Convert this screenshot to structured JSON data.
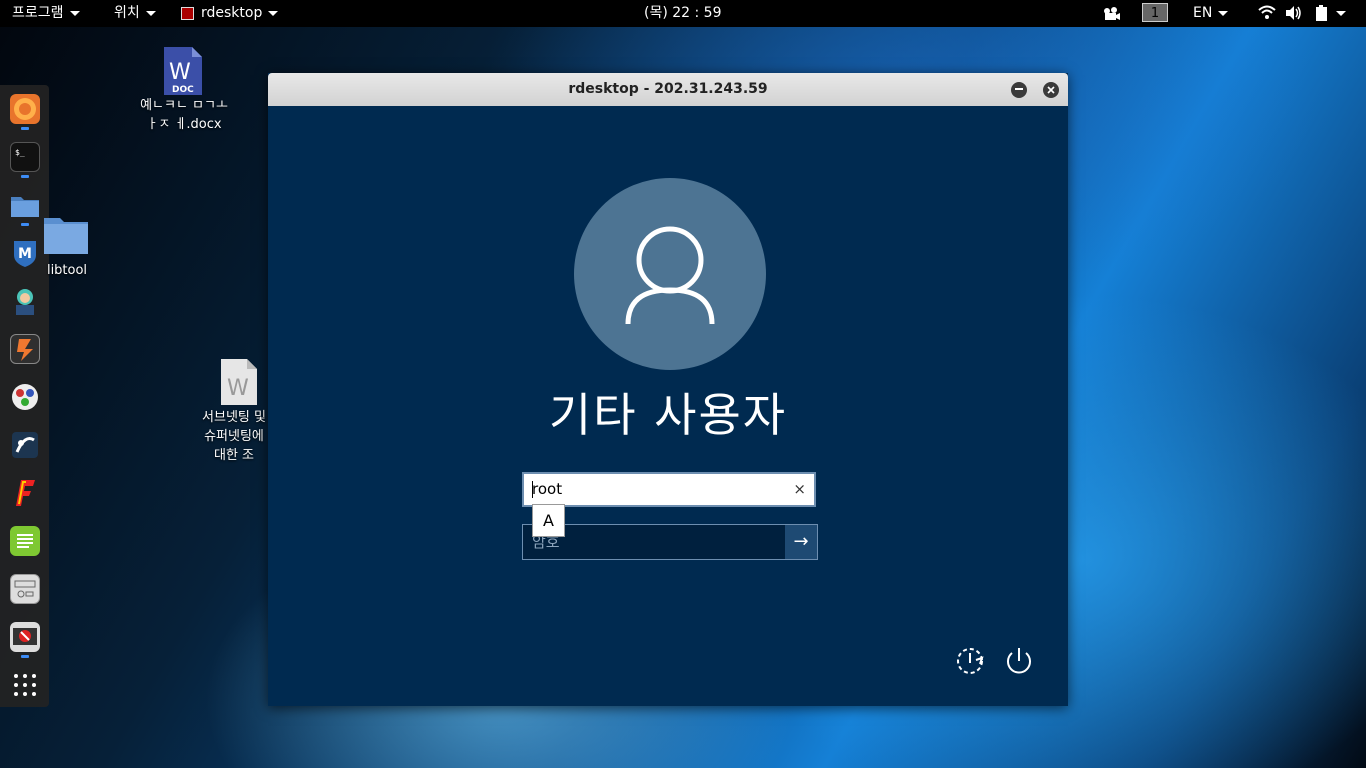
{
  "topbar": {
    "programs": "프로그램",
    "places": "위치",
    "active_app": "rdesktop",
    "clock": "(목) 22 : 59",
    "workspace": "1",
    "lang": "EN"
  },
  "desktop": {
    "icons": [
      {
        "label": "예ㄴㅋㄴ ㅁㄱㅗㅏㅈ ㅔ.docx",
        "badge": "DOC"
      },
      {
        "label": "libtool"
      },
      {
        "label": "서브넷팅 및 슈퍼넷팅에 대한 조사.docx"
      }
    ]
  },
  "window": {
    "title": "rdesktop - 202.31.243.59",
    "login": {
      "user_display": "기타 사용자",
      "username_value": "root",
      "password_placeholder": "암호",
      "ime_indicator": "A",
      "clear_glyph": "×",
      "submit_glyph": "→"
    }
  },
  "colors": {
    "window_bg": "#002a50",
    "avatar_bg": "#4d7493",
    "input_border": "#6d8eb0"
  }
}
